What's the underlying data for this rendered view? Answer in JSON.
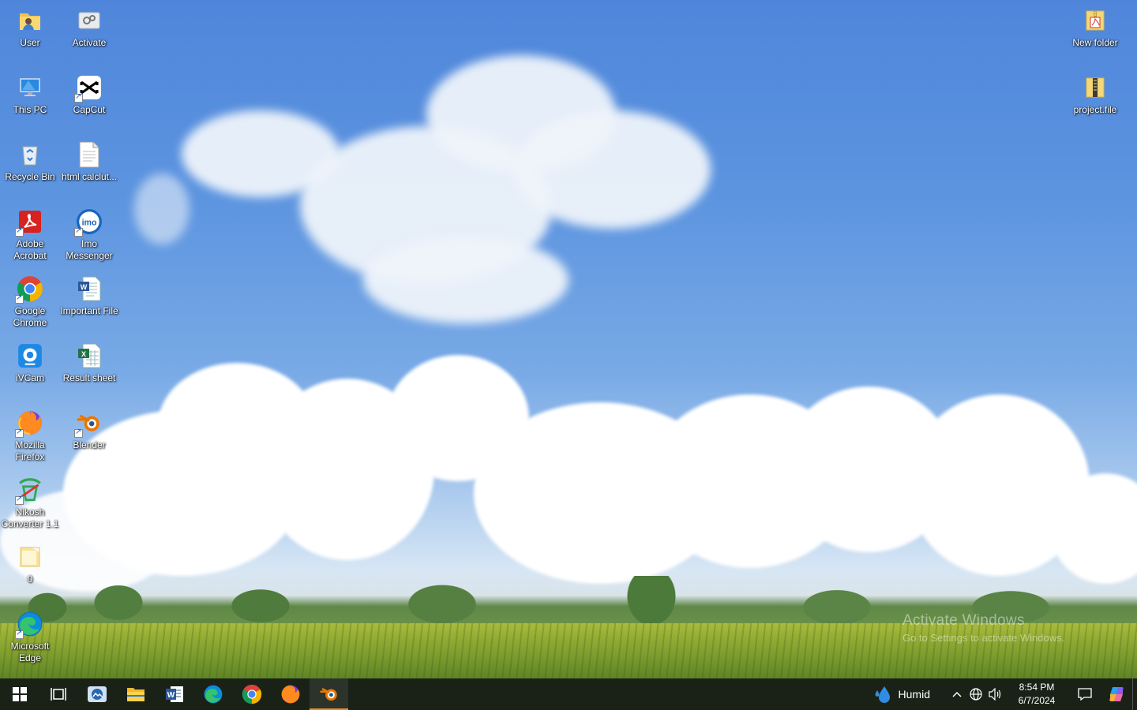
{
  "desktop": {
    "icons": [
      {
        "label": "User",
        "icon": "user-folder-icon"
      },
      {
        "label": "Activate",
        "icon": "activate-icon"
      },
      {
        "label": "This PC",
        "icon": "this-pc-icon"
      },
      {
        "label": "CapCut",
        "icon": "capcut-icon"
      },
      {
        "label": "Recycle Bin",
        "icon": "recycle-bin-icon"
      },
      {
        "label": "html calclut...",
        "icon": "text-file-icon"
      },
      {
        "label": "Adobe Acrobat",
        "icon": "adobe-acrobat-icon"
      },
      {
        "label": "Imo Messenger",
        "icon": "imo-icon"
      },
      {
        "label": "Google Chrome",
        "icon": "chrome-icon"
      },
      {
        "label": "Important File",
        "icon": "word-doc-icon"
      },
      {
        "label": "iVCam",
        "icon": "ivcam-icon"
      },
      {
        "label": "Result sheet",
        "icon": "excel-sheet-icon"
      },
      {
        "label": "Mozilla Firefox",
        "icon": "firefox-icon"
      },
      {
        "label": "Blender",
        "icon": "blender-icon"
      },
      {
        "label": "Nikosh Converter 1.1",
        "icon": "nikosh-icon"
      },
      {
        "label": "0",
        "icon": "folder-icon"
      },
      {
        "label": "Microsoft Edge",
        "icon": "edge-icon"
      },
      {
        "label": "New folder",
        "icon": "zip-folder-icon"
      },
      {
        "label": "project.file",
        "icon": "zip-folder-icon"
      }
    ],
    "watermark": {
      "title": "Activate Windows",
      "subtitle": "Go to Settings to activate Windows."
    }
  },
  "taskbar": {
    "pinned": [
      "start-icon",
      "task-view-icon",
      "photos-app-icon",
      "file-explorer-icon",
      "word-icon",
      "edge-icon",
      "chrome-icon",
      "firefox-icon",
      "blender-icon"
    ],
    "active_app": "blender-icon",
    "weather": {
      "label": "Humid",
      "icon": "raindrop-icon"
    },
    "clock": {
      "time": "8:54 PM",
      "date": "6/7/2024"
    }
  }
}
